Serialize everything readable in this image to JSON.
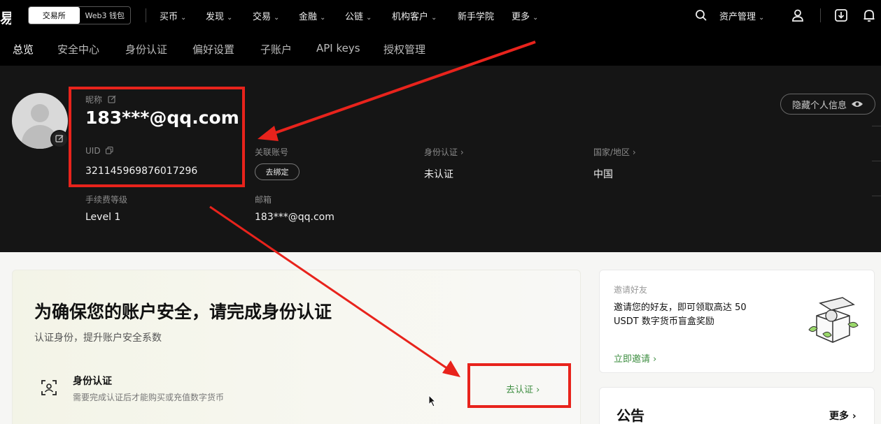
{
  "topbar": {
    "logo_fragment": "易",
    "mode_tabs": [
      "交易所",
      "Web3 钱包"
    ],
    "nav": [
      {
        "label": "买币",
        "has_dropdown": true
      },
      {
        "label": "发现",
        "has_dropdown": true
      },
      {
        "label": "交易",
        "has_dropdown": true
      },
      {
        "label": "金融",
        "has_dropdown": true
      },
      {
        "label": "公链",
        "has_dropdown": true
      },
      {
        "label": "机构客户",
        "has_dropdown": true
      },
      {
        "label": "新手学院",
        "has_dropdown": false
      },
      {
        "label": "更多",
        "has_dropdown": true
      }
    ],
    "assets_label": "资产管理",
    "icons": [
      "search-icon",
      "user-icon",
      "download-icon",
      "bell-icon"
    ]
  },
  "subnav": {
    "items": [
      "总览",
      "安全中心",
      "身份认证",
      "偏好设置",
      "子账户",
      "API keys",
      "授权管理"
    ],
    "active_index": 0
  },
  "profile": {
    "nickname_label": "昵称",
    "nickname": "183***@qq.com",
    "uid_label": "UID",
    "uid": "321145969876017296",
    "fee_label": "手续费等级",
    "fee_level": "Level 1",
    "linked_label": "关联账号",
    "bind_button": "去绑定",
    "email_label": "邮箱",
    "email": "183***@qq.com",
    "kyc_label": "身份认证 ›",
    "kyc_status": "未认证",
    "country_label": "国家/地区 ›",
    "country": "中国",
    "hide_info": "隐藏个人信息"
  },
  "verify_card": {
    "title": "为确保您的账户安全，请完成身份认证",
    "subtitle": "认证身份，提升账户安全系数",
    "item_title": "身份认证",
    "item_desc": "需要完成认证后才能购买或充值数字货币",
    "action": "去认证 ›"
  },
  "invite_card": {
    "label": "邀请好友",
    "text": "邀请您的好友，即可领取高达 50 USDT 数字货币盲盒奖励",
    "link": "立即邀请 ›"
  },
  "notice_card": {
    "title": "公告",
    "more": "更多 ›"
  },
  "colors": {
    "accent_green": "#3e8e41",
    "annotation_red": "#e8231c",
    "header_bg": "#000000",
    "profile_bg": "#151515"
  }
}
